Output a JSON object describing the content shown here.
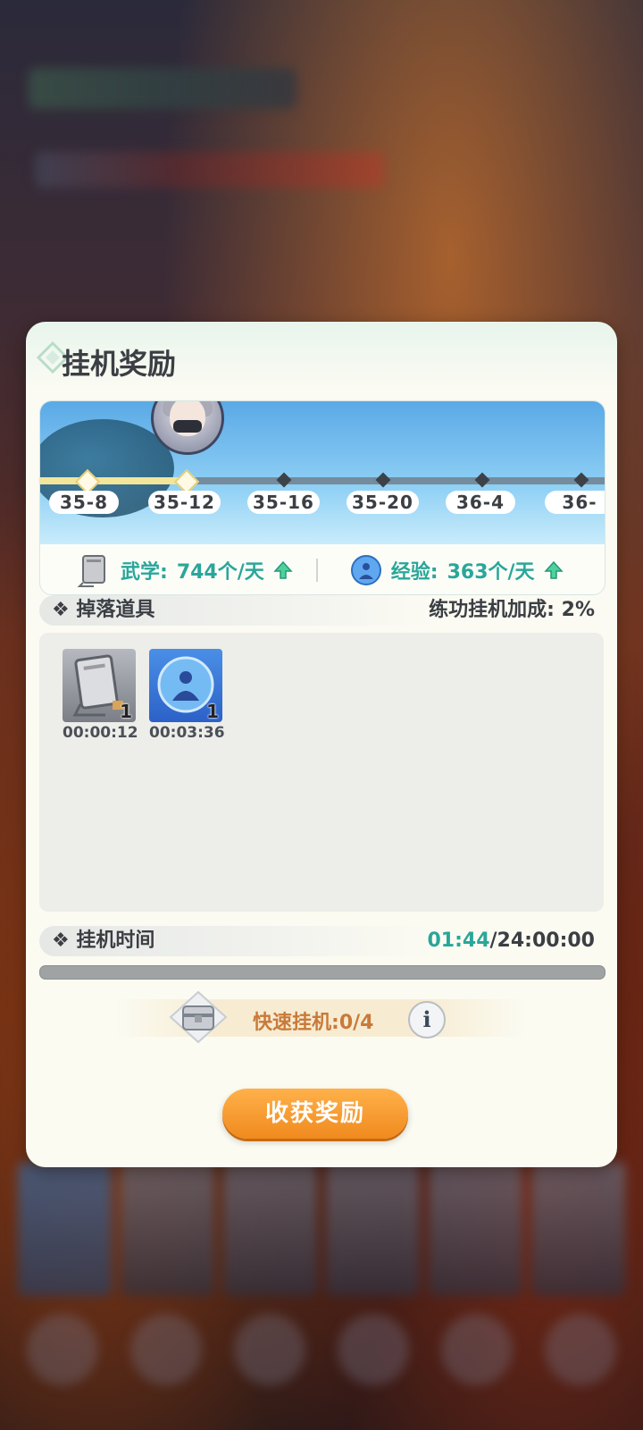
{
  "modal": {
    "title": "挂机奖励"
  },
  "stages": [
    "35-8",
    "35-12",
    "35-16",
    "35-20",
    "36-4",
    "36-"
  ],
  "rates": {
    "wuxue_label": "武学:",
    "wuxue_value": "744个/天",
    "exp_label": "经验:",
    "exp_value": "363个/天"
  },
  "drops": {
    "title": "掉落道具",
    "bonus_label": "练功挂机加成:",
    "bonus_value": "2%",
    "items": [
      {
        "icon": "book-icon",
        "count": "1",
        "time": "00:00:12"
      },
      {
        "icon": "exp-orb-icon",
        "count": "1",
        "time": "00:03:36"
      }
    ]
  },
  "idle_time": {
    "title": "挂机时间",
    "current": "01:44",
    "max": "/24:00:00",
    "progress": 0.001
  },
  "quick_idle": {
    "label": "快速挂机:",
    "value": "0/4"
  },
  "collect_button": "收获奖励",
  "colors": {
    "accent_teal": "#2aa69a",
    "button_orange": "#f08a1e",
    "quick_text": "#c97a3a"
  }
}
